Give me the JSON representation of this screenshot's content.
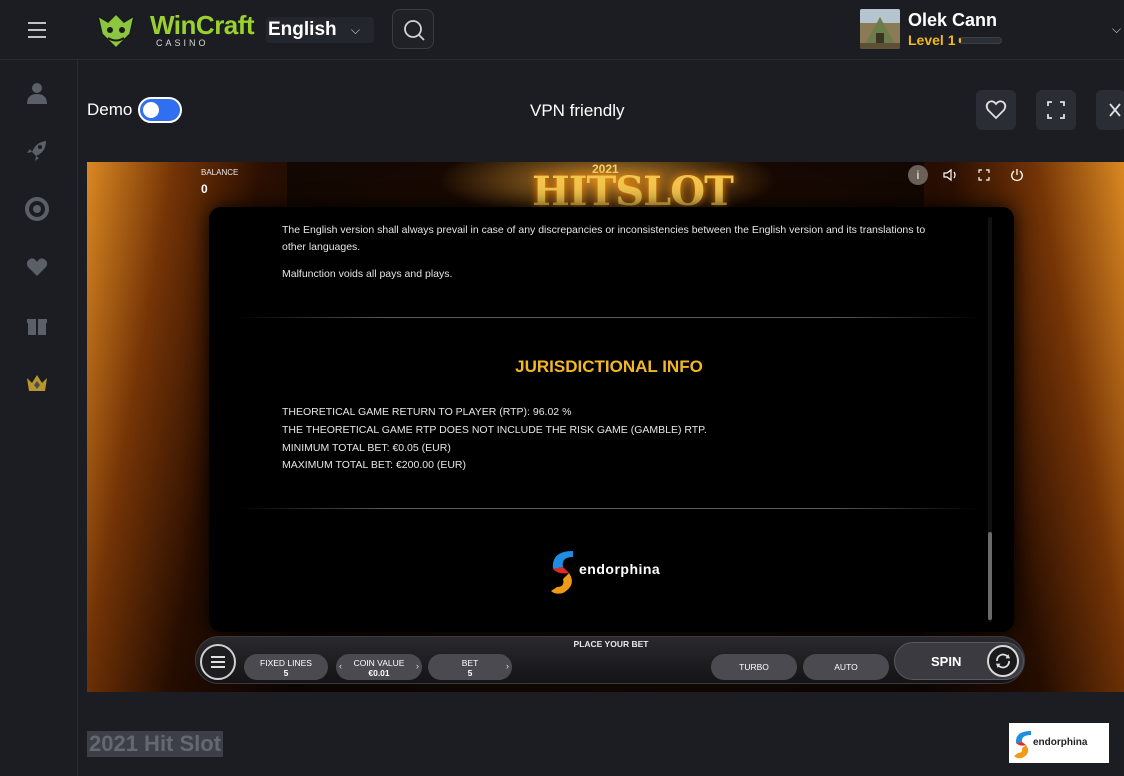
{
  "header": {
    "logo": {
      "name": "WinCraft",
      "sub": "CASINO"
    },
    "language": "English",
    "user": {
      "name": "Olek Cann",
      "level": "Level 1",
      "level_progress": 0.05
    }
  },
  "sidebar": {
    "items": [
      {
        "icon": "user-icon"
      },
      {
        "icon": "rocket-icon"
      },
      {
        "icon": "lifebuoy-icon"
      },
      {
        "icon": "heart-icon"
      },
      {
        "icon": "gift-icon"
      },
      {
        "icon": "crown-icon"
      }
    ]
  },
  "toolbar": {
    "demo_label": "Demo",
    "demo_enabled": true,
    "vpn_label": "VPN friendly"
  },
  "game": {
    "title_year": "2021",
    "title_name": "HITSLOT",
    "balance_label": "BALANCE",
    "balance_value": "0",
    "info": {
      "paragraph_1": "The English version shall always prevail in case of any discrepancies or inconsistencies between the English version and its translations to other languages.",
      "paragraph_2": "Malfunction voids all pays and plays.",
      "section_title": "JURISDICTIONAL INFO",
      "line_1": "THEORETICAL GAME RETURN TO PLAYER (RTP): 96.02 %",
      "line_2": "THE THEORETICAL GAME RTP DOES NOT INCLUDE THE RISK GAME (GAMBLE) RTP.",
      "line_3": "MINIMUM TOTAL BET: €0.05 (EUR)",
      "line_4": "MAXIMUM TOTAL BET: €200.00 (EUR)",
      "provider": "endorphina"
    },
    "controls": {
      "place_bet": "PLACE YOUR BET",
      "fixed_lines_label": "FIXED LINES",
      "fixed_lines_value": "5",
      "coin_value_label": "COIN VALUE",
      "coin_value_value": "€0.01",
      "bet_label": "BET",
      "bet_value": "5",
      "turbo_label": "TURBO",
      "auto_label": "AUTO",
      "spin_label": "SPIN"
    }
  },
  "footer": {
    "game_name": "2021 Hit Slot",
    "provider": "endorphina"
  },
  "colors": {
    "accent_green": "#9bd12f",
    "level_gold": "#f2b91a",
    "toggle_blue": "#2f6ff0",
    "juris_gold": "#f3b821"
  }
}
